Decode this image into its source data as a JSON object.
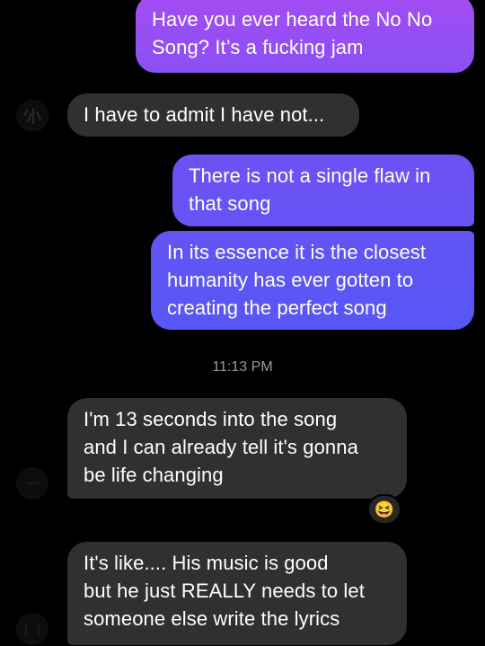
{
  "conversation": {
    "messages": [
      {
        "sender": "me",
        "lines": [
          "Have you ever heard the No No",
          "Song? It’s a fucking jam"
        ]
      },
      {
        "sender": "them",
        "lines": [
          "I have to admit I have not..."
        ]
      },
      {
        "sender": "me",
        "lines": [
          "There is not a single flaw in",
          "that song"
        ]
      },
      {
        "sender": "me",
        "lines": [
          "In its essence it is the closest",
          "humanity has ever gotten to",
          "creating the perfect song"
        ]
      },
      {
        "sender": "them",
        "lines": [
          "I'm 13 seconds into the song",
          "and I can already tell it's gonna",
          "be life changing"
        ]
      },
      {
        "sender": "them",
        "lines": [
          "It's like.... His music is good",
          "but he just REALLY needs to let",
          "someone else write the lyrics"
        ]
      }
    ],
    "timestamp": "11:13 PM",
    "reaction": {
      "emoji": "😆",
      "icon": "laughing-emoji-icon"
    }
  },
  "colors": {
    "background": "#000000",
    "received_bubble": "#303030",
    "sent_gradient_top": "#9b4ff3",
    "sent_gradient_bottom": "#5a55f5",
    "timestamp": "#9a9a9a"
  }
}
